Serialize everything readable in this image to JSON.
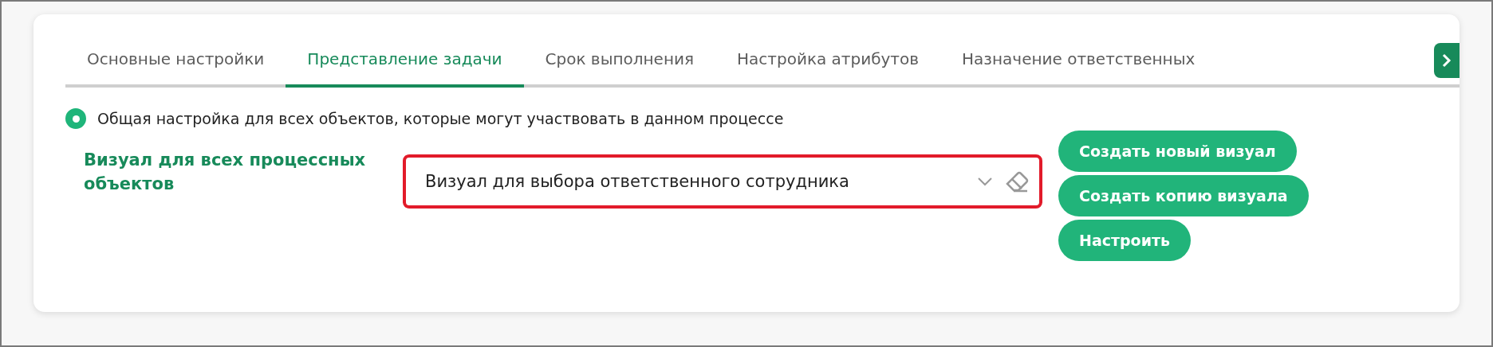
{
  "tabs": [
    {
      "label": "Основные настройки",
      "selected": false
    },
    {
      "label": "Представление задачи",
      "selected": true
    },
    {
      "label": "Срок выполнения",
      "selected": false
    },
    {
      "label": "Настройка атрибутов",
      "selected": false
    },
    {
      "label": "Назначение ответственных",
      "selected": false
    }
  ],
  "scope_option": {
    "label": "Общая настройка для всех объектов, которые могут участвовать в данном процессе",
    "selected": true
  },
  "visual_field": {
    "label": "Визуал для всех процессных объектов",
    "value": "Визуал для выбора ответственного сотрудника",
    "highlighted": true
  },
  "buttons": [
    "Создать новый визуал",
    "Создать копию визуала",
    "Настроить"
  ]
}
